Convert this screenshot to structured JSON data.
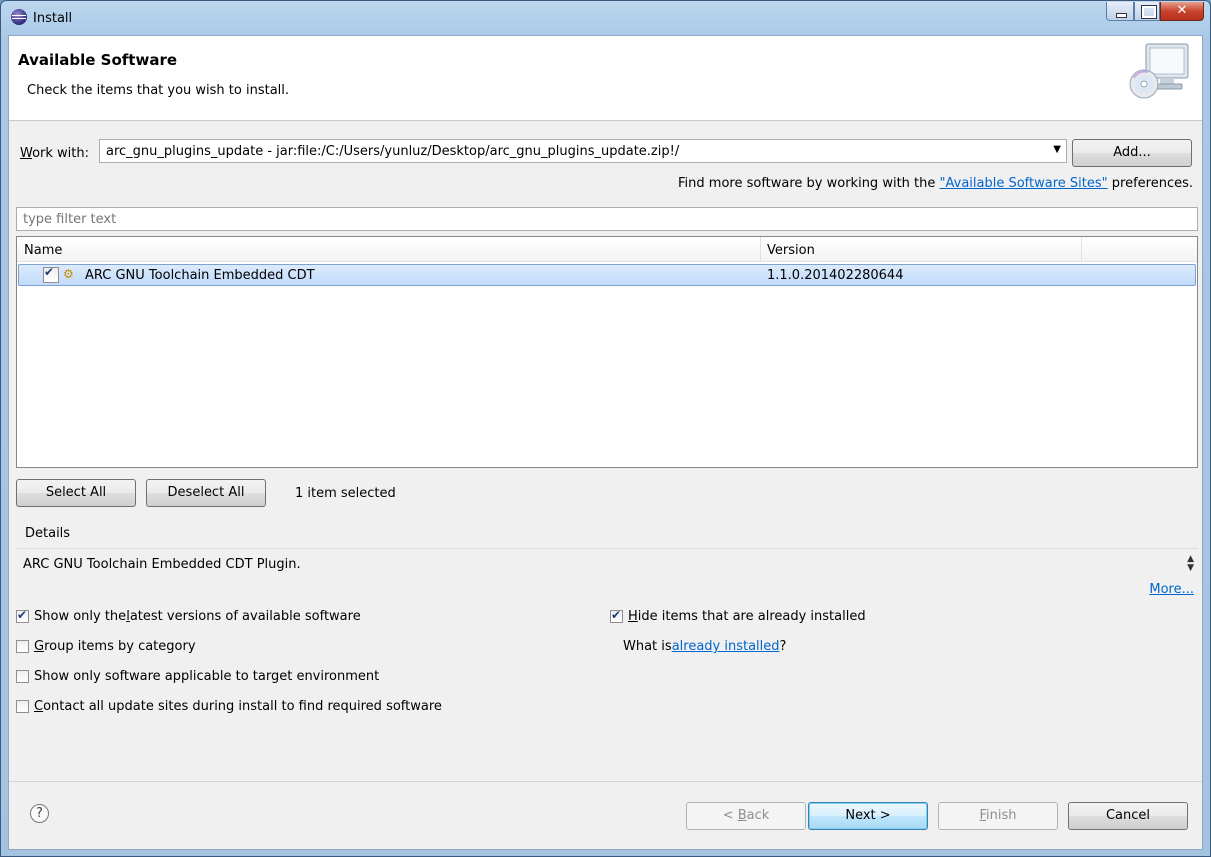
{
  "window": {
    "title": "Install"
  },
  "header": {
    "title": "Available Software",
    "description": "Check the items that you wish to install."
  },
  "work_with": {
    "label_prefix": "W",
    "label_rest": "ork with:",
    "value": "arc_gnu_plugins_update - jar:file:/C:/Users/yunluz/Desktop/arc_gnu_plugins_update.zip!/",
    "add_button": "Add..."
  },
  "find_more": {
    "prefix": "Find more software by working with the ",
    "link": "\"Available Software Sites\"",
    "suffix": " preferences."
  },
  "filter": {
    "placeholder": "type filter text"
  },
  "table": {
    "columns": [
      "Name",
      "Version"
    ],
    "rows": [
      {
        "name": "ARC GNU Toolchain Embedded CDT",
        "version": "1.1.0.201402280644",
        "checked": true
      }
    ]
  },
  "selection": {
    "select_all": "Select All",
    "deselect_all": "Deselect All",
    "count": "1 item selected"
  },
  "details": {
    "label": "Details",
    "text": "ARC GNU Toolchain Embedded CDT Plugin.",
    "more": "More..."
  },
  "options": {
    "latest_prefix": "Show only the ",
    "latest_u": "l",
    "latest_rest": "atest versions of available software",
    "latest_checked": true,
    "group_u": "G",
    "group_rest": "roup items by category",
    "group_checked": false,
    "target_env": "Show only software applicable to target environment",
    "target_checked": false,
    "contact_u": "C",
    "contact_rest": "ontact all update sites during install to find required software",
    "contact_checked": false,
    "hide_u": "H",
    "hide_rest": "ide items that are already installed",
    "hide_checked": true,
    "what_is_prefix": "What is ",
    "what_is_link": "already installed",
    "what_is_suffix": "?"
  },
  "footer": {
    "help": "?",
    "back_prefix": "< ",
    "back_u": "B",
    "back_rest": "ack",
    "next": "Next >",
    "finish_u": "F",
    "finish_rest": "inish",
    "cancel": "Cancel"
  }
}
